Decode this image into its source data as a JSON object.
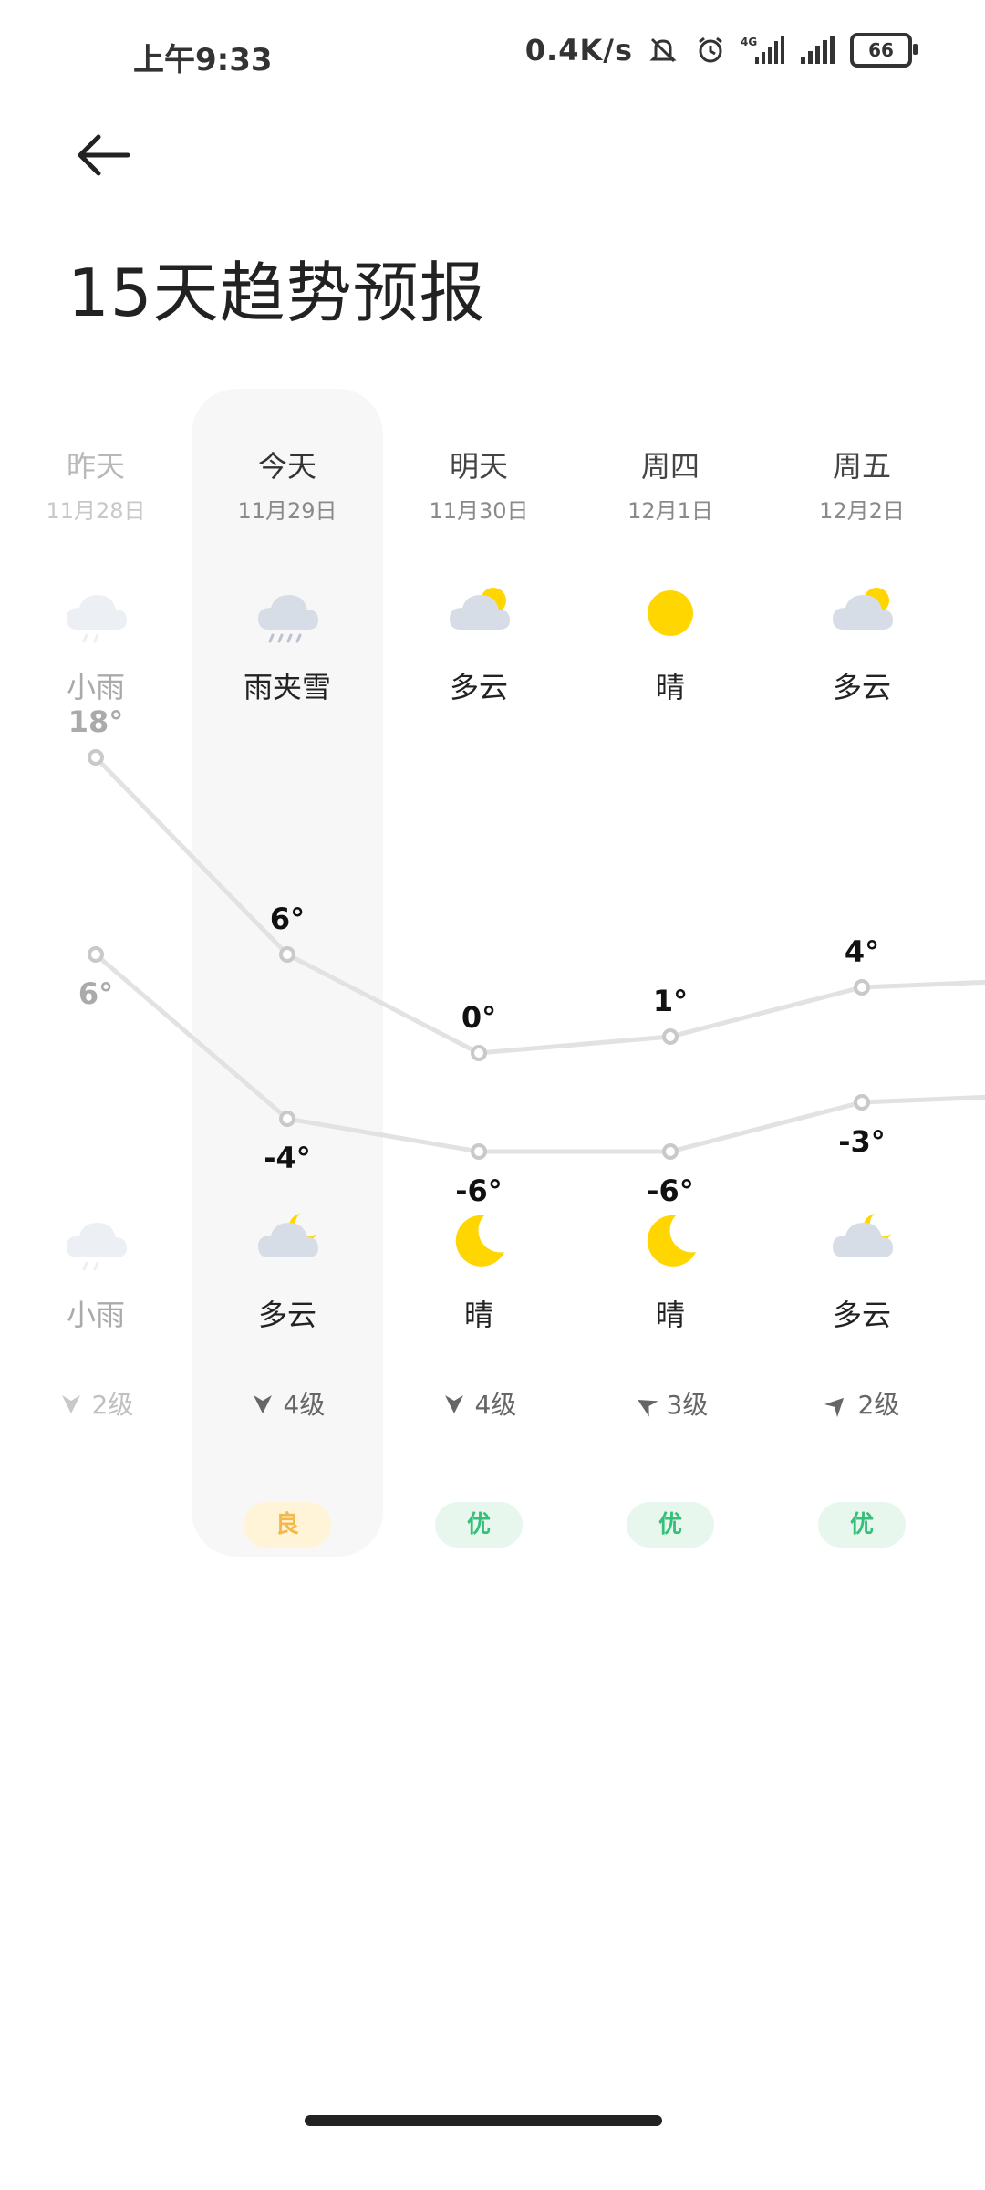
{
  "status_bar": {
    "time": "上午9:33",
    "net_speed": "0.4K/s",
    "battery": "66",
    "network_type": "4G",
    "icons": [
      "mute-icon",
      "alarm-icon",
      "signal-4g-icon",
      "signal-icon",
      "battery-icon"
    ]
  },
  "header": {
    "back_icon": "back-arrow-icon",
    "title": "15天趋势预报"
  },
  "days": [
    {
      "day": "昨天",
      "date": "11月28日",
      "day_cond": "小雨",
      "day_icon": "light-rain-icon",
      "high": "18°",
      "night_cond": "小雨",
      "night_icon": "light-rain-icon",
      "low": "6°",
      "wind": "2级",
      "wind_dir": "south-arrow",
      "aqi": "",
      "past": true
    },
    {
      "day": "今天",
      "date": "11月29日",
      "day_cond": "雨夹雪",
      "day_icon": "sleet-icon",
      "high": "6°",
      "night_cond": "多云",
      "night_icon": "cloudy-night-icon",
      "low": "-4°",
      "wind": "4级",
      "wind_dir": "south-arrow",
      "aqi": "良",
      "aqi_color": "#f3b94a"
    },
    {
      "day": "明天",
      "date": "11月30日",
      "day_cond": "多云",
      "day_icon": "partly-cloudy-icon",
      "high": "0°",
      "night_cond": "晴",
      "night_icon": "moon-icon",
      "low": "-6°",
      "wind": "4级",
      "wind_dir": "south-arrow",
      "aqi": "优",
      "aqi_color": "#35c07a"
    },
    {
      "day": "周四",
      "date": "12月1日",
      "day_cond": "晴",
      "day_icon": "sun-icon",
      "high": "1°",
      "night_cond": "晴",
      "night_icon": "moon-icon",
      "low": "-6°",
      "wind": "3级",
      "wind_dir": "west-arrow",
      "aqi": "优",
      "aqi_color": "#35c07a"
    },
    {
      "day": "周五",
      "date": "12月2日",
      "day_cond": "多云",
      "day_icon": "partly-cloudy-icon",
      "high": "4°",
      "night_cond": "多云",
      "night_icon": "cloudy-night-icon",
      "low": "-3°",
      "wind": "2级",
      "wind_dir": "northeast-arrow",
      "aqi": "优",
      "aqi_color": "#35c07a"
    }
  ],
  "chart_data": {
    "type": "line",
    "categories": [
      "昨天",
      "今天",
      "明天",
      "周四",
      "周五"
    ],
    "series": [
      {
        "values": [
          18,
          6,
          0,
          1,
          4
        ]
      },
      {
        "values": [
          6,
          -4,
          -6,
          -6,
          -3
        ]
      }
    ]
  },
  "colors": {
    "sun": "#ffd600",
    "cloud": "#d7dde6",
    "line": "#e2e2e2",
    "good_aqi_bg": "#e7f7ee",
    "moderate_aqi_bg": "#fff3d8"
  }
}
